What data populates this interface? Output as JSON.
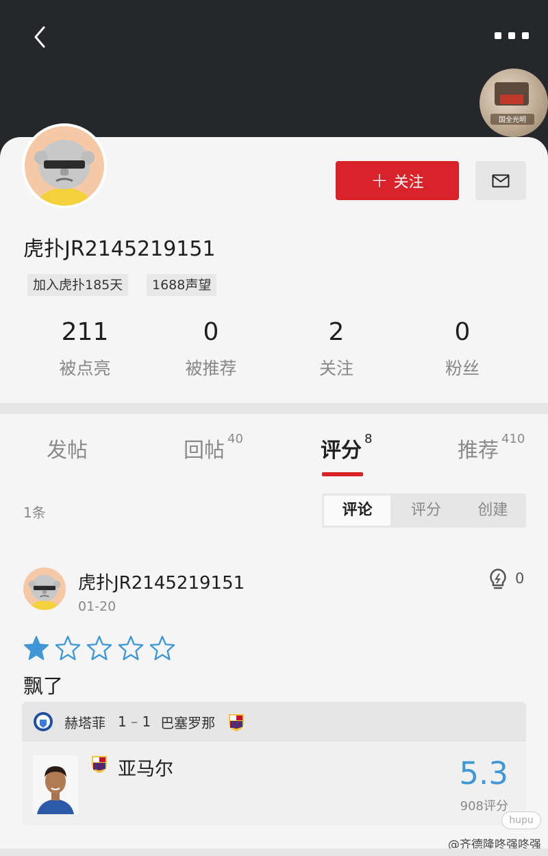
{
  "header": {
    "back_icon": "chevron-left-icon",
    "more_icon": "more-dots-icon",
    "badge_text": "国全光明"
  },
  "profile": {
    "username": "虎扑JR2145219151",
    "follow_label": "关注",
    "tags": [
      "加入虎扑185天",
      "1688声望"
    ],
    "stats": [
      {
        "value": "211",
        "label": "被点亮"
      },
      {
        "value": "0",
        "label": "被推荐"
      },
      {
        "value": "2",
        "label": "关注"
      },
      {
        "value": "0",
        "label": "粉丝"
      }
    ]
  },
  "tabs": [
    {
      "label": "发帖",
      "count": ""
    },
    {
      "label": "回帖",
      "count": "40"
    },
    {
      "label": "评分",
      "count": "8",
      "active": true
    },
    {
      "label": "推荐",
      "count": "410"
    }
  ],
  "list": {
    "count_text": "1条",
    "filters": [
      "评论",
      "评分",
      "创建"
    ],
    "active_filter": "评论"
  },
  "post": {
    "username": "虎扑JR2145219151",
    "date": "01-20",
    "light_count": "0",
    "stars_filled": 1,
    "stars_total": 5,
    "comment": "飘了",
    "match": {
      "home_team": "赫塔菲",
      "home_score": "1",
      "separator": "–",
      "away_score": "1",
      "away_team": "巴塞罗那"
    },
    "player": {
      "name": "亚马尔",
      "rating": "5.3",
      "rating_count": "908评分"
    }
  },
  "watermark": {
    "logo_text": "hupu",
    "text": "@齐德隆咚强咚强"
  },
  "colors": {
    "accent_red": "#d8232a",
    "rating_blue": "#3f97d6",
    "header_dark": "#25272b"
  }
}
